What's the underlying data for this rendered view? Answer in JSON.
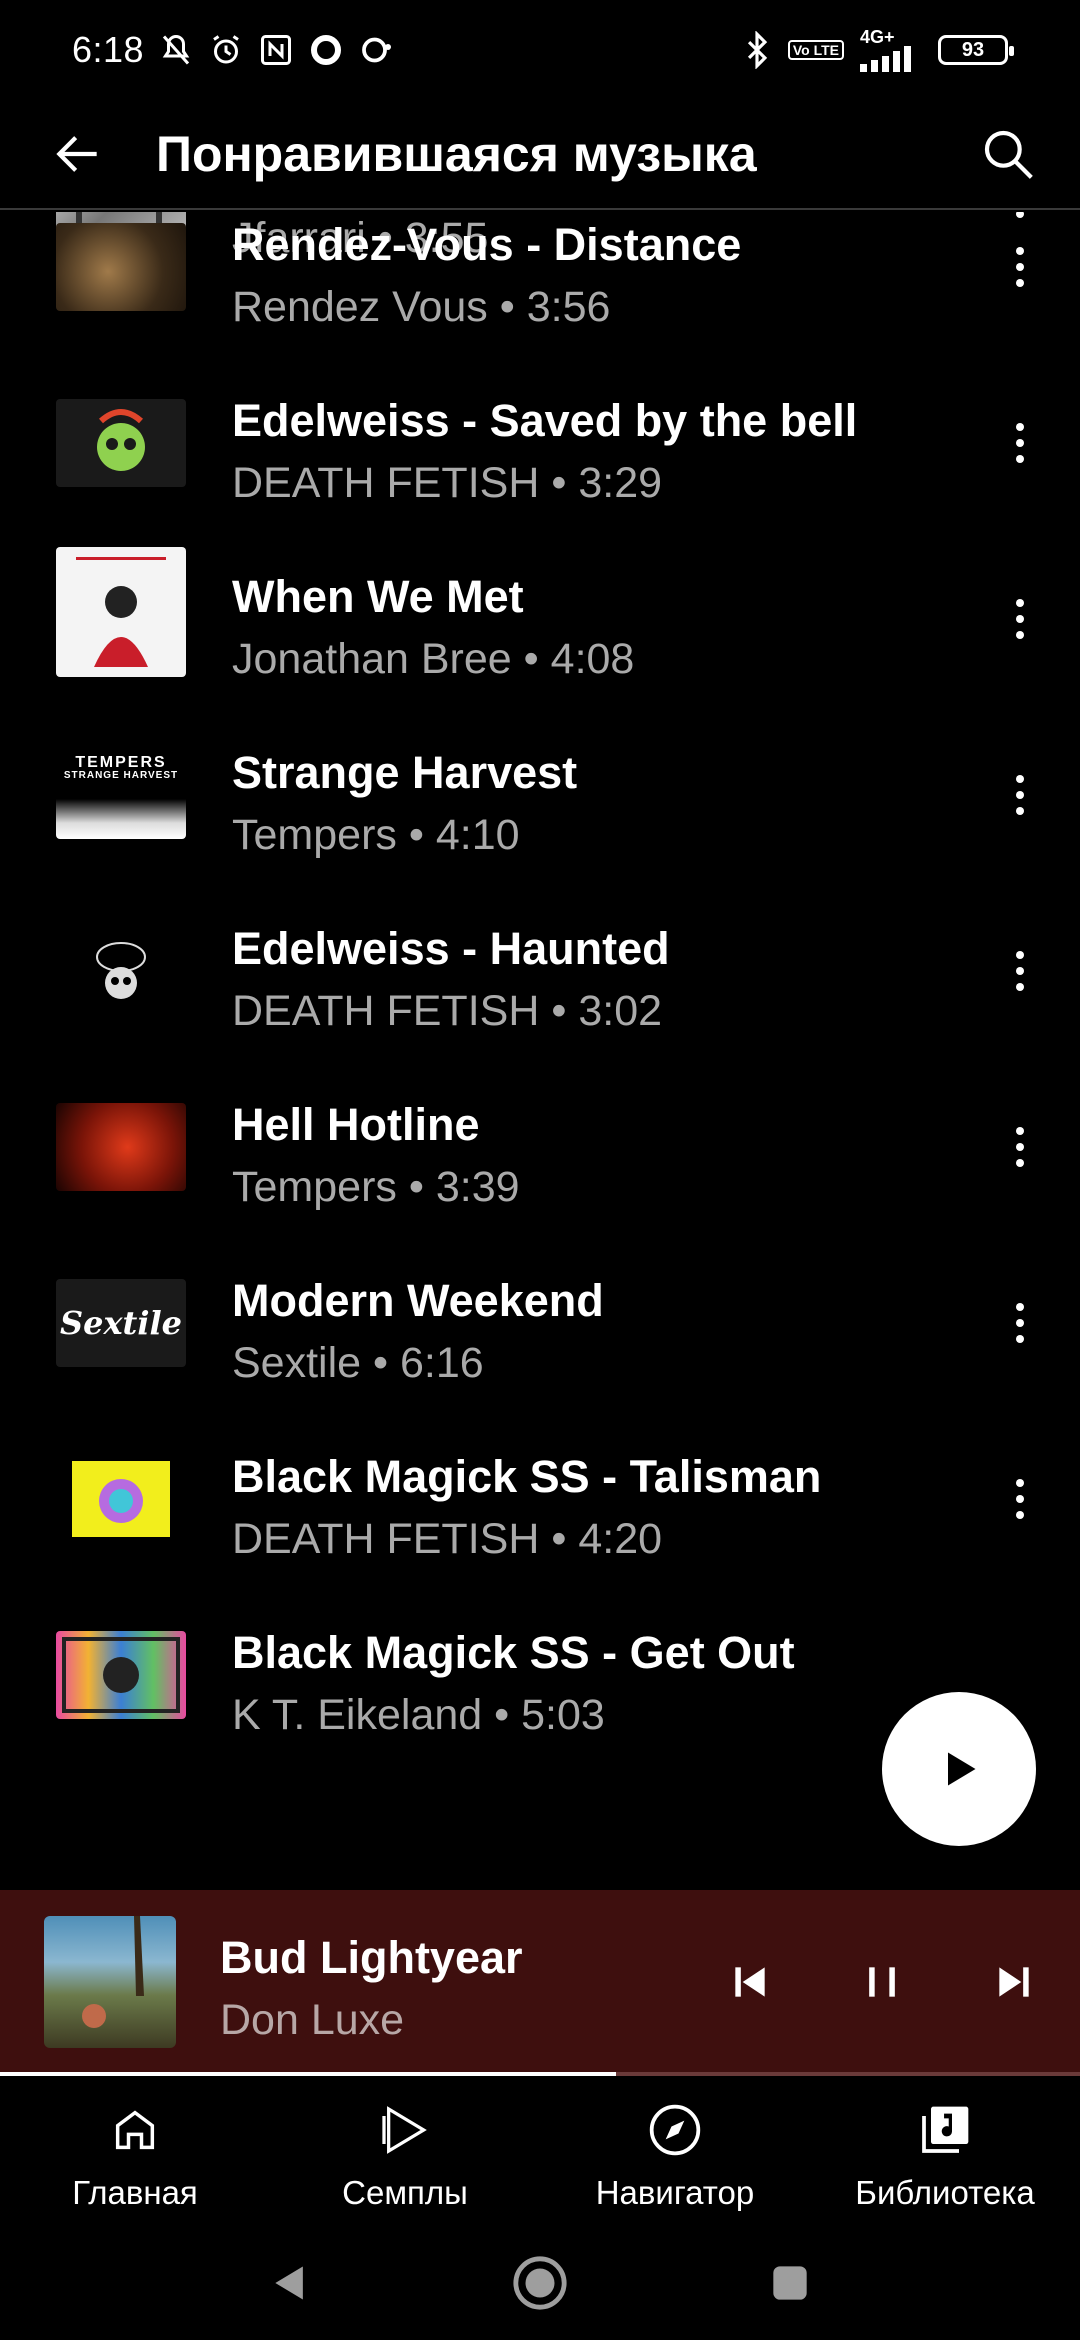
{
  "status_bar": {
    "time": "6:18",
    "network_badge": "Vo LTE",
    "network_type": "4G+",
    "battery": "93"
  },
  "header": {
    "title": "Понравившаяся музыка"
  },
  "tracks": [
    {
      "title": "",
      "subtitle": "Jfarrari • 3:55"
    },
    {
      "title": "Rendez-Vous - Distance",
      "subtitle": "Rendez Vous • 3:56"
    },
    {
      "title": "Edelweiss - Saved by the bell",
      "subtitle": "DEATH FETISH • 3:29"
    },
    {
      "title": "When We Met",
      "subtitle": "Jonathan Bree • 4:08"
    },
    {
      "title": "Strange Harvest",
      "subtitle": "Tempers • 4:10",
      "thumb_text": "TEMPERS",
      "thumb_subtext": "STRANGE HARVEST"
    },
    {
      "title": "Edelweiss - Haunted",
      "subtitle": "DEATH FETISH • 3:02"
    },
    {
      "title": "Hell Hotline",
      "subtitle": "Tempers • 3:39"
    },
    {
      "title": "Modern Weekend",
      "subtitle": "Sextile • 6:16",
      "thumb_text": "Sextile"
    },
    {
      "title": "Black Magick SS - Talisman",
      "subtitle": "DEATH FETISH • 4:20"
    },
    {
      "title": "Black Magick SS - Get Out",
      "subtitle": "K T. Eikeland • 5:03"
    }
  ],
  "now_playing": {
    "title": "Bud Lightyear",
    "artist": "Don Luxe",
    "progress": 0.57
  },
  "bottom_nav": {
    "home": "Главная",
    "samples": "Семплы",
    "explore": "Навигатор",
    "library": "Библиотека"
  },
  "colors": {
    "background": "#000000",
    "mini_player": "#3e0f0e",
    "secondary_text": "#aaaaaa"
  }
}
